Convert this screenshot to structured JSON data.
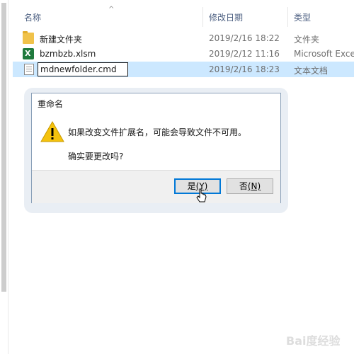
{
  "explorer": {
    "columns": {
      "name": "名称",
      "date_modified": "修改日期",
      "type": "类型",
      "sort_icon": "chevron-up-icon"
    },
    "files": [
      {
        "icon": "folder-icon",
        "name": "新建文件夹",
        "date": "2019/2/16 18:22",
        "type": "文件夹"
      },
      {
        "icon": "excel-file-icon",
        "name": "bzmbzb.xlsm",
        "date": "2019/2/12 11:16",
        "type": "Microsoft Excel"
      },
      {
        "icon": "text-file-icon",
        "name": "mdnewfolder.cmd",
        "date": "2019/2/16 18:23",
        "type": "文本文档",
        "selected": true,
        "editing": true
      }
    ]
  },
  "dialog": {
    "title": "重命名",
    "icon": "warning-icon",
    "message": "如果改变文件扩展名，可能会导致文件不可用。",
    "confirm": "确实要更改吗?",
    "yes_button": {
      "label": "是",
      "mnemonic": "(Y)"
    },
    "no_button": {
      "label": "否",
      "mnemonic": "(N)"
    }
  },
  "colors": {
    "selection": "#cce8ff",
    "header_text": "#4d6082",
    "accent": "#0078d7",
    "warning": "#f4c20d"
  },
  "watermark": {
    "text": "Bai度经验"
  }
}
